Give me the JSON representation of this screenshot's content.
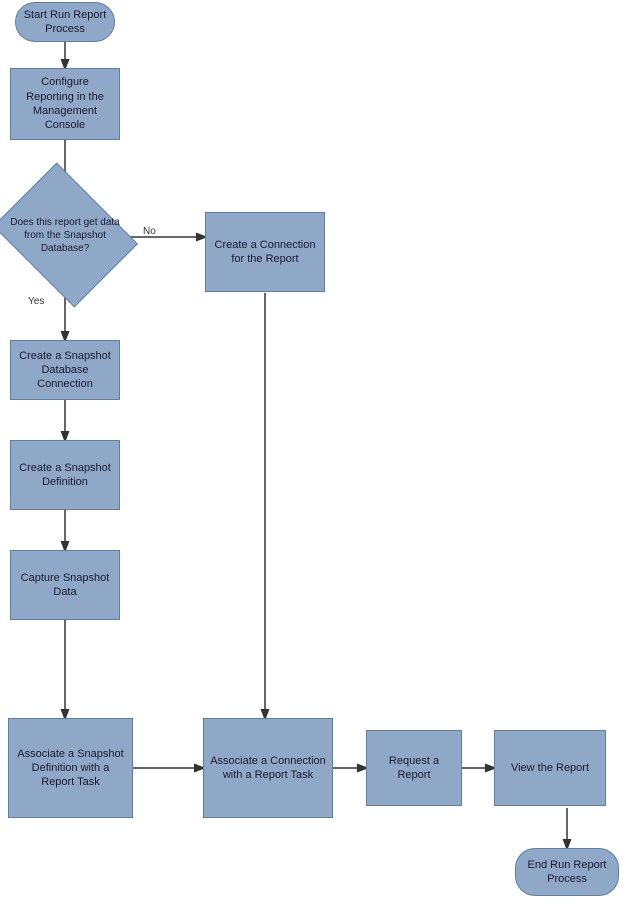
{
  "nodes": {
    "start": {
      "label": "Start Run Report\nProcess"
    },
    "configure": {
      "label": "Configure Reporting in\nthe Management\nConsole"
    },
    "decision": {
      "label": "Does this report get\ndata from the\nSnapshot Database?"
    },
    "create_connection": {
      "label": "Create a Connection\nfor the Report"
    },
    "snapshot_db_conn": {
      "label": "Create a Snapshot\nDatabase Connection"
    },
    "snapshot_def": {
      "label": "Create a Snapshot\nDefinition"
    },
    "capture_snapshot": {
      "label": "Capture Snapshot\nData"
    },
    "assoc_snapshot": {
      "label": "Associate a Snapshot\nDefinition with a\nReport Task"
    },
    "assoc_connection": {
      "label": "Associate a\nConnection with a\nReport Task"
    },
    "request_report": {
      "label": "Request a Report"
    },
    "view_report": {
      "label": "View the Report"
    },
    "end": {
      "label": "End Run Report\nProcess"
    },
    "yes_label": {
      "label": "Yes"
    },
    "no_label": {
      "label": "No"
    }
  }
}
